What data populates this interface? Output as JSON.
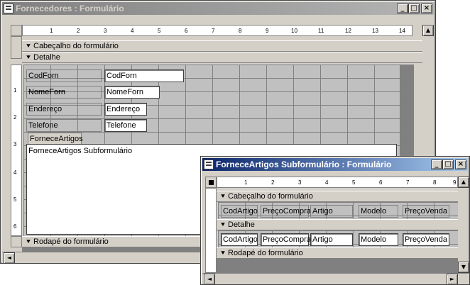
{
  "main_window": {
    "title": "Fornecedores : Formulário",
    "buttons": {
      "minimize": "_",
      "maximize": "□",
      "close": "×"
    },
    "ruler_ticks": [
      "1",
      "2",
      "3",
      "4",
      "5",
      "6",
      "7",
      "8",
      "9",
      "10",
      "11",
      "12",
      "13",
      "14"
    ],
    "vruler_ticks": [
      "1",
      "2",
      "3",
      "4",
      "5",
      "6"
    ],
    "sections": {
      "header": "Cabeçalho do formulário",
      "detail": "Detalhe",
      "footer": "Rodapé do formulário"
    },
    "fields": [
      {
        "label": "CodForn",
        "control": "CodForn"
      },
      {
        "label": "NomeForn",
        "control": "NomeForn"
      },
      {
        "label": "Endereço",
        "control": "Endereço"
      },
      {
        "label": "Telefone",
        "control": "Telefone"
      }
    ],
    "subform_label": "ForneceArtigos",
    "subform_text": "ForneceArtigos Subformulário"
  },
  "sub_window": {
    "title": "ForneceArtigos Subformulário : Formulário",
    "buttons": {
      "minimize": "_",
      "maximize": "□",
      "close": "×"
    },
    "ruler_ticks": [
      "1",
      "2",
      "3",
      "4",
      "5",
      "6",
      "7",
      "8",
      "9"
    ],
    "sections": {
      "header": "Cabeçalho do formulário",
      "detail": "Detalhe",
      "footer": "Rodapé do formulário"
    },
    "header_labels": [
      "CodArtigo",
      "PreçoCompra",
      "Artigo",
      "Modelo",
      "PreçoVenda"
    ],
    "detail_controls": [
      "CodArtigo",
      "PreçoCompra",
      "Artigo",
      "Modelo",
      "PreçoVenda"
    ]
  },
  "icons": {
    "up": "▲",
    "down": "▼",
    "left": "◄",
    "right": "►",
    "section_arrow": "⯆"
  }
}
